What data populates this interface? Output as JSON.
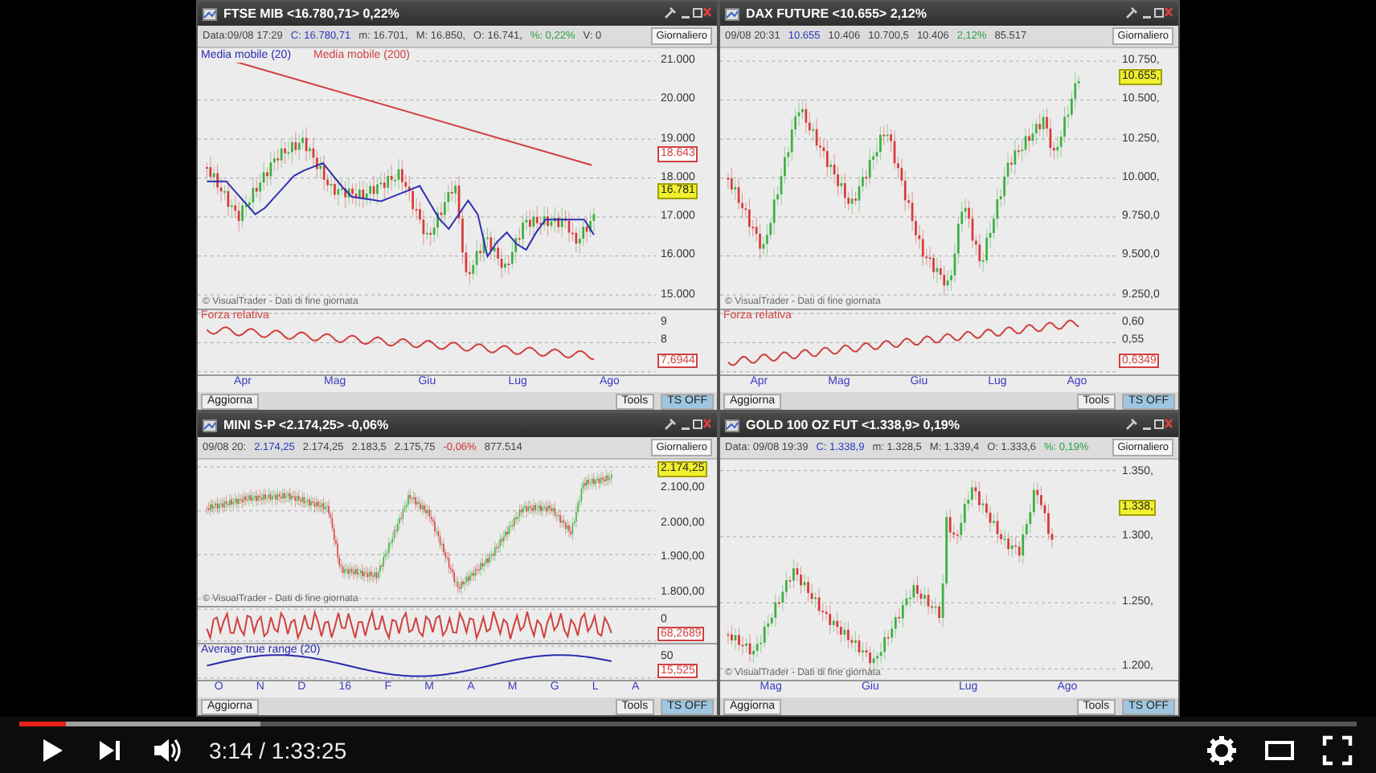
{
  "panels": [
    {
      "title": "FTSE MIB <16.780,71> 0,22%",
      "quote": [
        {
          "text": "Data:09/08 17:29",
          "kind": "plain"
        },
        {
          "text": "C: 16.780,71",
          "kind": "price"
        },
        {
          "text": "m: 16.701,",
          "kind": "plain"
        },
        {
          "text": "M: 16.850,",
          "kind": "plain"
        },
        {
          "text": "O: 16.741,",
          "kind": "plain"
        },
        {
          "text": "%: 0,22%",
          "kind": "up"
        },
        {
          "text": "V: 0",
          "kind": "plain"
        }
      ],
      "interval": "Giornaliero",
      "legend": [
        {
          "text": "Media mobile (20)",
          "color": "#2a2ab0"
        },
        {
          "text": "Media mobile (200)",
          "color": "#d04040"
        }
      ],
      "yticks": [
        "21.000",
        "20.000",
        "19.000",
        "18.000",
        "17.000",
        "16.000",
        "15.000"
      ],
      "tags": [
        {
          "text": "18.643",
          "kind": "line"
        },
        {
          "text": "16.781",
          "kind": "price"
        }
      ],
      "watermark": "© VisualTrader - Dati di fine giornata",
      "indicators": [
        {
          "label": "Forza relativa",
          "color": "#d04040",
          "ticks": [
            "9",
            "8"
          ],
          "tag": "7,6944"
        }
      ],
      "xlabels": [
        "Apr",
        "Mag",
        "Giu",
        "Lug",
        "Ago"
      ],
      "footer": {
        "refresh": "Aggiorna",
        "tools": "Tools",
        "ts": "TS OFF"
      }
    },
    {
      "title": "DAX FUTURE <10.655> 2,12%",
      "quote": [
        {
          "text": "09/08 20:31",
          "kind": "plain"
        },
        {
          "text": "10.655",
          "kind": "price"
        },
        {
          "text": "10.406",
          "kind": "plain"
        },
        {
          "text": "10.700,5",
          "kind": "plain"
        },
        {
          "text": "10.406",
          "kind": "plain"
        },
        {
          "text": "2,12%",
          "kind": "up"
        },
        {
          "text": "85.517",
          "kind": "plain"
        }
      ],
      "interval": "Giornaliero",
      "yticks": [
        "10.750,",
        "10.500,",
        "10.250,",
        "10.000,",
        "9.750,0",
        "9.500,0",
        "9.250,0"
      ],
      "tags": [
        {
          "text": "10.655,",
          "kind": "price"
        }
      ],
      "watermark": "© VisualTrader - Dati di fine giornata",
      "indicators": [
        {
          "label": "Forza relativa",
          "color": "#d04040",
          "ticks": [
            "0,60",
            "0,55"
          ],
          "tag": "0,6349"
        }
      ],
      "xlabels": [
        "Apr",
        "Mag",
        "Giu",
        "Lug",
        "Ago"
      ],
      "footer": {
        "refresh": "Aggiorna",
        "tools": "Tools",
        "ts": "TS OFF"
      }
    },
    {
      "title": "MINI S-P <2.174,25> -0,06%",
      "quote": [
        {
          "text": "09/08 20:",
          "kind": "plain"
        },
        {
          "text": "2.174,25",
          "kind": "price"
        },
        {
          "text": "2.174,25",
          "kind": "plain"
        },
        {
          "text": "2.183,5",
          "kind": "plain"
        },
        {
          "text": "2.175,75",
          "kind": "plain"
        },
        {
          "text": "-0,06%",
          "kind": "down"
        },
        {
          "text": "877.514",
          "kind": "plain"
        }
      ],
      "interval": "Giornaliero",
      "yticks": [
        "2.100,00",
        "2.000,00",
        "1.900,00",
        "1.800,00"
      ],
      "tags": [
        {
          "text": "2.174,25",
          "kind": "price"
        }
      ],
      "watermark": "© VisualTrader - Dati di fine giornata",
      "indicators": [
        {
          "color": "#d04040",
          "ticks": [
            "0"
          ],
          "tag": "68,2689"
        },
        {
          "label": "Average true range (20)",
          "color": "#2a2ab0",
          "ticks": [
            "50"
          ],
          "tag": "15,525"
        }
      ],
      "xlabels": [
        "O",
        "N",
        "D",
        "16",
        "F",
        "M",
        "A",
        "M",
        "G",
        "L",
        "A"
      ],
      "footer": {
        "refresh": "Aggiorna",
        "tools": "Tools",
        "ts": "TS OFF"
      }
    },
    {
      "title": "GOLD 100 OZ FUT <1.338,9> 0,19%",
      "quote": [
        {
          "text": "Data: 09/08 19:39",
          "kind": "plain"
        },
        {
          "text": "C: 1.338,9",
          "kind": "price"
        },
        {
          "text": "m: 1.328,5",
          "kind": "plain"
        },
        {
          "text": "M: 1.339,4",
          "kind": "plain"
        },
        {
          "text": "O: 1.333,6",
          "kind": "plain"
        },
        {
          "text": "%: 0,19%",
          "kind": "up"
        }
      ],
      "interval": "Giornaliero",
      "yticks": [
        "1.350,",
        "1.300,",
        "1.250,",
        "1.200,"
      ],
      "tags": [
        {
          "text": "1.338,",
          "kind": "price"
        }
      ],
      "watermark": "© VisualTrader - Dati di fine giornata",
      "xlabels": [
        "Mag",
        "Giu",
        "Lug",
        "Ago"
      ],
      "footer": {
        "refresh": "Aggiorna",
        "tools": "Tools",
        "ts": "TS OFF"
      }
    }
  ],
  "player": {
    "level": 0.035,
    "time": "3:14 / 1:33:25"
  }
}
